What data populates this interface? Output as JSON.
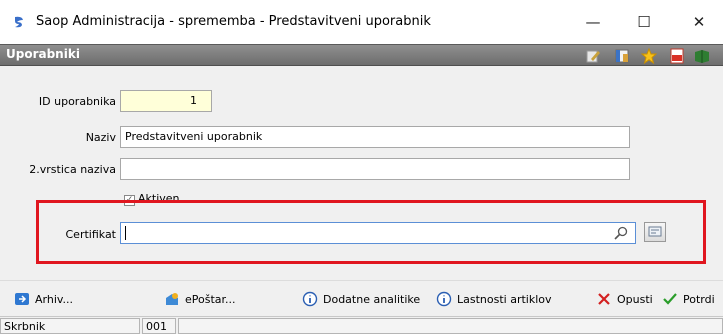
{
  "window": {
    "title": "Saop Administracija - sprememba - Predstavitveni uporabnik",
    "minimize_glyph": "—",
    "maximize_glyph": "☐",
    "close_glyph": "✕"
  },
  "header": {
    "title": "Uporabniki",
    "icons": [
      "edit-icon",
      "columns-icon",
      "star-icon",
      "pdf-icon",
      "book-icon"
    ]
  },
  "form": {
    "id_label": "ID uporabnika",
    "id_value": "1",
    "naziv_label": "Naziv",
    "naziv_value": "Predstavitveni uporabnik",
    "naziv2_label": "2.vrstica naziva",
    "naziv2_value": "",
    "aktiven_label": "Aktiven",
    "aktiven_checked": true,
    "certifikat_label": "Certifikat",
    "certifikat_value": ""
  },
  "toolbar": {
    "arhiv": "Arhiv...",
    "eposta": "ePoštar...",
    "dodatne": "Dodatne analitike",
    "lastnosti": "Lastnosti artiklov",
    "opusti": "Opusti",
    "potrdi": "Potrdi"
  },
  "statusbar": {
    "label": "Skrbnik",
    "code": "001",
    "extra": ""
  },
  "colors": {
    "header_bg": "#7d7d7d",
    "highlight_border": "#e0161f",
    "id_field_bg": "#ffffd9",
    "focus_border": "#5b8fd6"
  }
}
